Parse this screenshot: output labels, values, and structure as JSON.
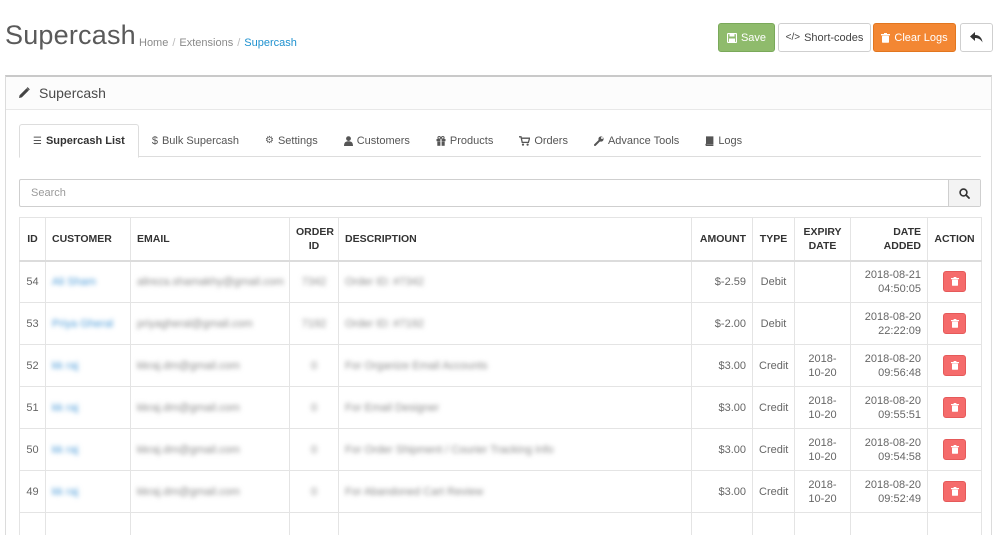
{
  "header": {
    "title": "Supercash",
    "breadcrumb": [
      "Home",
      "Extensions",
      "Supercash"
    ],
    "buttons": {
      "save": "Save",
      "shortcodes": "Short-codes",
      "clear_logs": "Clear Logs"
    }
  },
  "panel": {
    "title": "Supercash",
    "tabs": [
      {
        "label": "Supercash List",
        "icon": "list-icon",
        "active": true
      },
      {
        "label": "Bulk Supercash",
        "icon": "dollar-icon",
        "active": false
      },
      {
        "label": "Settings",
        "icon": "gear-icon",
        "active": false
      },
      {
        "label": "Customers",
        "icon": "user-icon",
        "active": false
      },
      {
        "label": "Products",
        "icon": "gift-icon",
        "active": false
      },
      {
        "label": "Orders",
        "icon": "cart-icon",
        "active": false
      },
      {
        "label": "Advance Tools",
        "icon": "wrench-icon",
        "active": false
      },
      {
        "label": "Logs",
        "icon": "book-icon",
        "active": false
      }
    ],
    "search": {
      "placeholder": "Search"
    }
  },
  "table": {
    "headers": {
      "id": "ID",
      "customer": "CUSTOMER",
      "email": "EMAIL",
      "order_id_1": "ORDER",
      "order_id_2": "ID",
      "description": "DESCRIPTION",
      "amount": "AMOUNT",
      "type": "TYPE",
      "expiry_1": "EXPIRY",
      "expiry_2": "DATE",
      "date_1": "DATE",
      "date_2": "ADDED",
      "action": "ACTION"
    },
    "rows": [
      {
        "id": "54",
        "customer": "Ali Sham",
        "email": "alireza.shamakhy@gmail.com",
        "order_id": "7342",
        "description": "Order ID: #7342",
        "amount": "$-2.59",
        "type": "Debit",
        "expiry_1": "",
        "expiry_2": "",
        "date_1": "2018-08-21",
        "date_2": "04:50:05"
      },
      {
        "id": "53",
        "customer": "Priya Gheral",
        "email": "priyagheral@gmail.com",
        "order_id": "7192",
        "description": "Order ID: #7192",
        "amount": "$-2.00",
        "type": "Debit",
        "expiry_1": "",
        "expiry_2": "",
        "date_1": "2018-08-20",
        "date_2": "22:22:09"
      },
      {
        "id": "52",
        "customer": "kk raj",
        "email": "kkraj.dm@gmail.com",
        "order_id": "0",
        "description": "For Organize Email Accounts",
        "amount": "$3.00",
        "type": "Credit",
        "expiry_1": "2018-",
        "expiry_2": "10-20",
        "date_1": "2018-08-20",
        "date_2": "09:56:48"
      },
      {
        "id": "51",
        "customer": "kk raj",
        "email": "kkraj.dm@gmail.com",
        "order_id": "0",
        "description": "For Email Designer",
        "amount": "$3.00",
        "type": "Credit",
        "expiry_1": "2018-",
        "expiry_2": "10-20",
        "date_1": "2018-08-20",
        "date_2": "09:55:51"
      },
      {
        "id": "50",
        "customer": "kk raj",
        "email": "kkraj.dm@gmail.com",
        "order_id": "0",
        "description": "For Order Shipment / Courier Tracking Info",
        "amount": "$3.00",
        "type": "Credit",
        "expiry_1": "2018-",
        "expiry_2": "10-20",
        "date_1": "2018-08-20",
        "date_2": "09:54:58"
      },
      {
        "id": "49",
        "customer": "kk raj",
        "email": "kkraj.dm@gmail.com",
        "order_id": "0",
        "description": "For Abandoned Cart Review",
        "amount": "$3.00",
        "type": "Credit",
        "expiry_1": "2018-",
        "expiry_2": "10-20",
        "date_1": "2018-08-20",
        "date_2": "09:52:49"
      },
      {
        "id": "",
        "customer": "",
        "email": "",
        "order_id": "",
        "description": "",
        "amount": "",
        "type": "",
        "expiry_1": "",
        "expiry_2": "",
        "date_1": "",
        "date_2": ""
      }
    ]
  },
  "colors": {
    "save": "#8fbb6c",
    "clear_logs": "#f38733",
    "delete": "#f56b6b",
    "link": "#1e91cf"
  }
}
